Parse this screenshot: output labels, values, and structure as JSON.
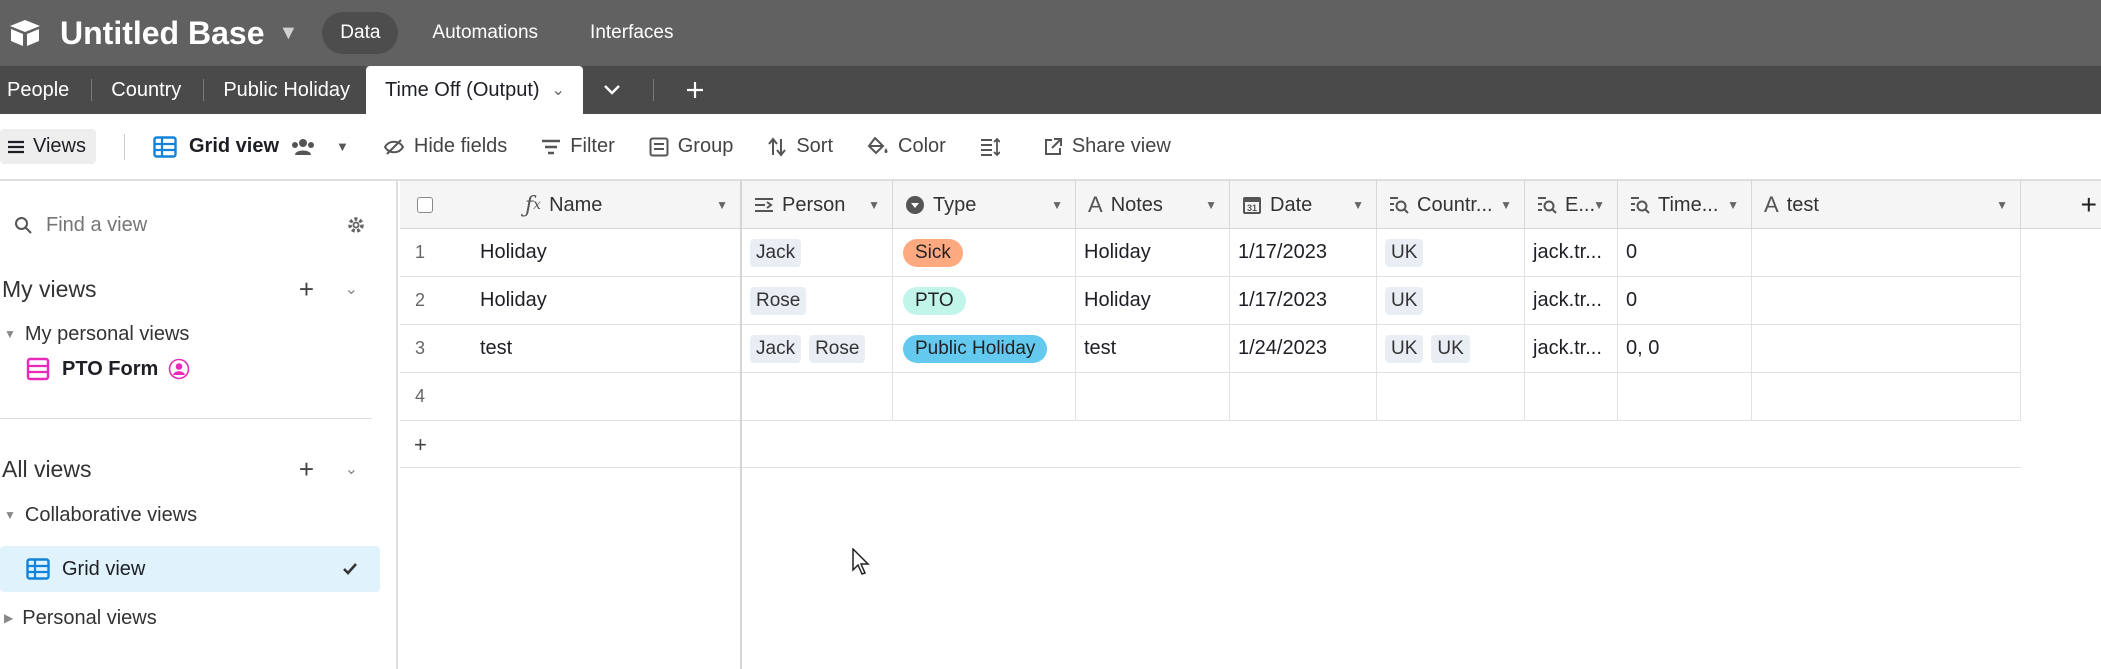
{
  "header": {
    "base_title": "Untitled Base",
    "nav": [
      {
        "label": "Data",
        "active": true
      },
      {
        "label": "Automations",
        "active": false
      },
      {
        "label": "Interfaces",
        "active": false
      }
    ]
  },
  "tabs": {
    "items": [
      "People",
      "Country",
      "Public Holiday"
    ],
    "active": "Time Off (Output)"
  },
  "toolbar": {
    "views_label": "Views",
    "view_name": "Grid view",
    "hide_fields": "Hide fields",
    "filter": "Filter",
    "group": "Group",
    "sort": "Sort",
    "color": "Color",
    "share_view": "Share view"
  },
  "sidebar": {
    "find_placeholder": "Find a view",
    "my_views": "My views",
    "my_personal_views": "My personal views",
    "pto_form": "PTO Form",
    "all_views": "All views",
    "collaborative_views": "Collaborative views",
    "grid_view": "Grid view",
    "personal_views": "Personal views"
  },
  "grid": {
    "columns": [
      "Name",
      "Person",
      "Type",
      "Notes",
      "Date",
      "Countr...",
      "E...",
      "Time...",
      "test"
    ],
    "add_row": "+",
    "add_col": "+",
    "rows": [
      {
        "num": "1",
        "name": "Holiday",
        "person": [
          "Jack"
        ],
        "type": "Sick",
        "notes": "Holiday",
        "date": "1/17/2023",
        "country": [
          "UK"
        ],
        "email": "jack.tr...",
        "time": "0",
        "test": ""
      },
      {
        "num": "2",
        "name": "Holiday",
        "person": [
          "Rose"
        ],
        "type": "PTO",
        "notes": "Holiday",
        "date": "1/17/2023",
        "country": [
          "UK"
        ],
        "email": "jack.tr...",
        "time": "0",
        "test": ""
      },
      {
        "num": "3",
        "name": "test",
        "person": [
          "Jack",
          "Rose"
        ],
        "type": "Public Holiday",
        "notes": "test",
        "date": "1/24/2023",
        "country": [
          "UK",
          "UK"
        ],
        "email": "jack.tr...",
        "time": "0, 0",
        "test": ""
      },
      {
        "num": "4",
        "name": "",
        "person": [],
        "type": "",
        "notes": "",
        "date": "",
        "country": [],
        "email": "",
        "time": "",
        "test": ""
      }
    ]
  },
  "colors": {
    "topbar": "#616161",
    "tabbar": "#4a4a4a",
    "sick": "#ffa981",
    "pto": "#c2f5e9",
    "public_holiday": "#63c9ef",
    "selected_view": "#e0f2fc",
    "grid_icon": "#1283da",
    "form_icon": "#e929ba"
  }
}
